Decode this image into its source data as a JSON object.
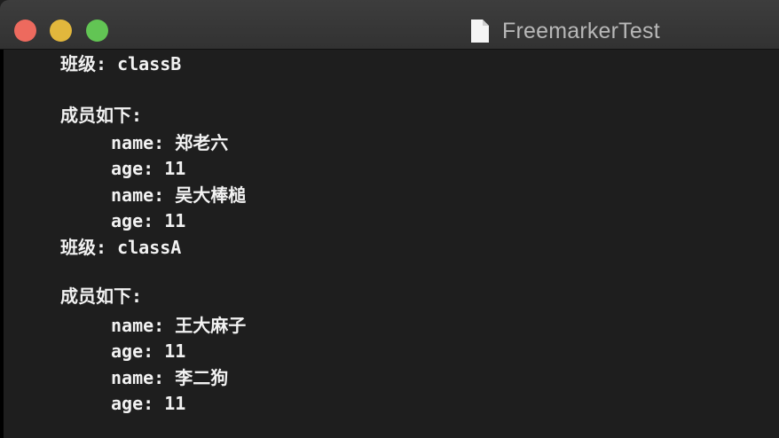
{
  "window": {
    "title": "FreemarkerTest"
  },
  "terminal": {
    "lines": [
      "班级: classB",
      "",
      "成员如下:",
      "name: 郑老六",
      "age: 11",
      "name: 吴大棒槌",
      "age: 11",
      "班级: classA",
      "",
      "成员如下:",
      "name: 王大麻子",
      "age: 11",
      "name: 李二狗",
      "age: 11"
    ]
  },
  "icons": {
    "close": "close-button",
    "minimize": "minimize-button",
    "maximize": "zoom-button",
    "document": "document-icon"
  },
  "colors": {
    "close": "#ed6a5e",
    "minimize": "#e2b73c",
    "maximize": "#62c554",
    "background": "#1e1e1e",
    "text": "#f2f2f2"
  }
}
